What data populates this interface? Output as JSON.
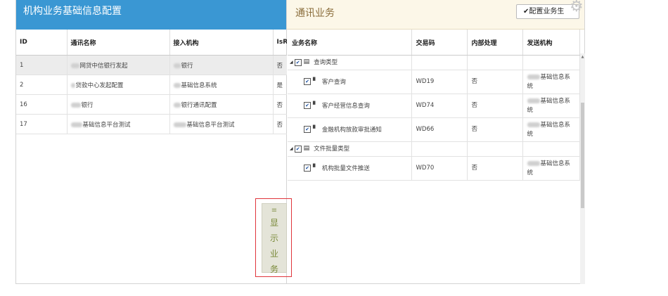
{
  "left_panel": {
    "title": "机构业务基础信息配置",
    "columns": [
      "ID",
      "通讯名称",
      "接入机构",
      "IsR"
    ],
    "rows": [
      {
        "id": "1",
        "name": "网贷中信银行发起",
        "org": "银行",
        "isr": "否"
      },
      {
        "id": "2",
        "name": "贷款中心发起配置",
        "org": "基础信息系统",
        "isr": "是"
      },
      {
        "id": "16",
        "name": "银行",
        "org": "银行通讯配置",
        "isr": "否"
      },
      {
        "id": "17",
        "name": "基础信息平台测试",
        "org": "基础信息平台测试",
        "isr": "否"
      }
    ]
  },
  "right_panel": {
    "title": "通讯业务",
    "config_button": "✔配置业务生",
    "columns": [
      "业务名称",
      "交易码",
      "内部处理",
      "发送机构"
    ],
    "groups": [
      {
        "name": "查询类型",
        "items": [
          {
            "name": "客户查询",
            "code": "WD19",
            "internal": "否",
            "sender_a": "基础信息系",
            "sender_b": "统"
          },
          {
            "name": "客户经营信息查询",
            "code": "WD74",
            "internal": "否",
            "sender_a": "基础信息系",
            "sender_b": "统"
          },
          {
            "name": "金融机构放款审批通知",
            "code": "WD66",
            "internal": "否",
            "sender_a": "基础信息系",
            "sender_b": "统"
          }
        ]
      },
      {
        "name": "文件批量类型",
        "items": [
          {
            "name": "机构批量文件推送",
            "code": "WD70",
            "internal": "否",
            "sender_a": "基础信息系",
            "sender_b": "统"
          }
        ]
      }
    ]
  },
  "show_button": {
    "chars": [
      "显",
      "示",
      "业",
      "务"
    ]
  },
  "icons": {
    "settings": "gear-icon",
    "menu": "menu-icon",
    "file": "file-icon",
    "folder": "table-icon",
    "check": "checkbox-checked-icon",
    "expand": "triangle-expand-icon"
  },
  "colors": {
    "left_header": "#3a97d3",
    "right_header": "#fcf7e8",
    "highlight": "#e0353b",
    "show_button_text": "#7a8a3a"
  }
}
